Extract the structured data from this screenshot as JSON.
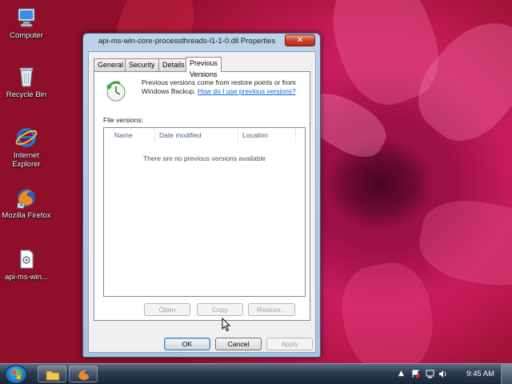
{
  "desktop": {
    "icons": [
      {
        "label": "Computer",
        "icon": "computer-icon"
      },
      {
        "label": "Recycle Bin",
        "icon": "recycle-bin-icon"
      },
      {
        "label": "Internet Explorer",
        "icon": "internet-explorer-icon"
      },
      {
        "label": "Mozilla Firefox",
        "icon": "firefox-icon"
      },
      {
        "label": "api-ms-win...",
        "icon": "dll-file-icon"
      }
    ]
  },
  "dialog": {
    "title": "api-ms-win-core-processthreads-l1-1-0.dll Properties",
    "close_label": "✕",
    "tabs": [
      {
        "label": "General",
        "active": false
      },
      {
        "label": "Security",
        "active": false
      },
      {
        "label": "Details",
        "active": false
      },
      {
        "label": "Previous Versions",
        "active": true
      }
    ],
    "info_text": "Previous versions come from restore points or from Windows Backup.",
    "help_link": "How do I use previous versions?",
    "file_versions_label": "File versions:",
    "columns": [
      "Name",
      "Date modified",
      "Location"
    ],
    "empty_message": "There are no previous versions available",
    "action_buttons": {
      "open": "Open",
      "copy": "Copy",
      "restore": "Restore..."
    },
    "footer_buttons": {
      "ok": "OK",
      "cancel": "Cancel",
      "apply": "Apply"
    }
  },
  "taskbar": {
    "pinned": [
      "explorer-icon",
      "firefox-icon"
    ],
    "clock": "9:45 AM",
    "tray_icons": [
      "show-hidden-icon",
      "action-center-icon",
      "network-icon",
      "volume-icon"
    ]
  },
  "colors": {
    "link": "#0066cc",
    "dialog_frame": "#bcd3ea",
    "close_button": "#c8462b",
    "taskbar": "#2a3a50"
  }
}
